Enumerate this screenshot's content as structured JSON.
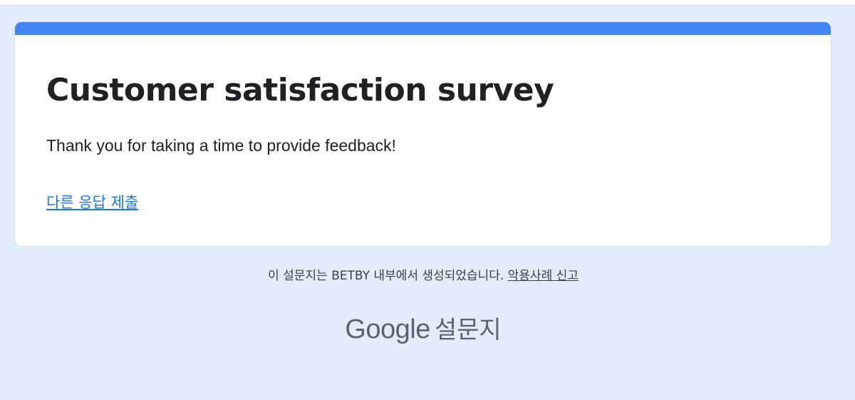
{
  "form": {
    "title": "Customer satisfaction survey",
    "message": "Thank you for taking a time to provide feedback!",
    "submit_another_link": "다른 응답 제출"
  },
  "footer": {
    "note": "이 설문지는 BETBY 내부에서 생성되었습니다.",
    "report_abuse_link": "악용사례 신고"
  },
  "brand": {
    "google": "Google",
    "product": "설문지"
  },
  "colors": {
    "page_background": "#e3ecfa",
    "accent": "#4285f4",
    "link": "#1a73e8"
  }
}
